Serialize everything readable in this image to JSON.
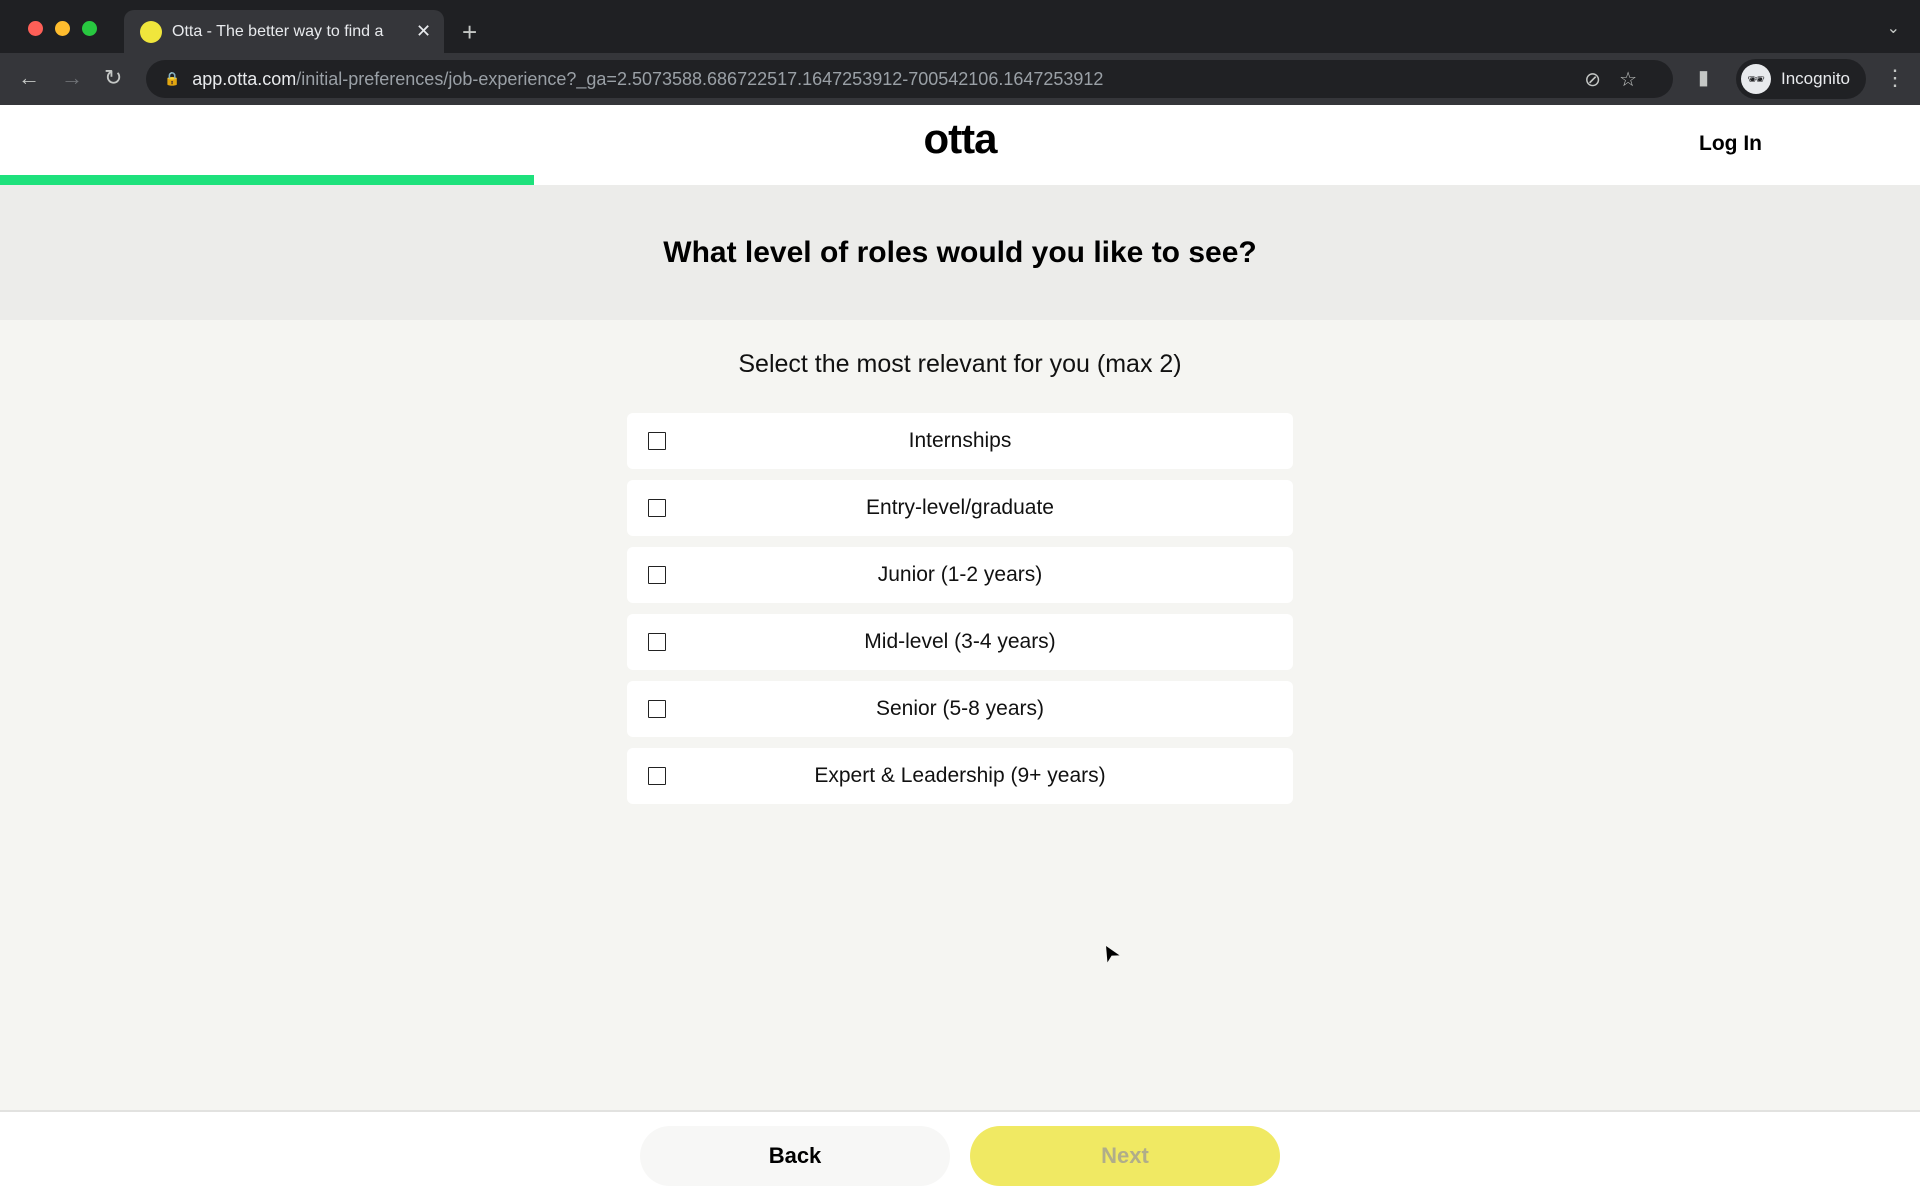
{
  "browser": {
    "tab_title": "Otta - The better way to find a",
    "favicon_text": "otta",
    "url_host": "app.otta.com",
    "url_path": "/initial-preferences/job-experience?_ga=2.5073588.686722517.1647253912-700542106.1647253912",
    "profile_label": "Incognito"
  },
  "header": {
    "logo": "otta",
    "login_label": "Log In",
    "progress_percent": 27.8
  },
  "question": {
    "title": "What level of roles would you like to see?",
    "subtitle": "Select the most relevant for you (max 2)"
  },
  "options": [
    {
      "label": "Internships",
      "checked": false
    },
    {
      "label": "Entry-level/graduate",
      "checked": false
    },
    {
      "label": "Junior (1-2 years)",
      "checked": false
    },
    {
      "label": "Mid-level (3-4 years)",
      "checked": false
    },
    {
      "label": "Senior (5-8 years)",
      "checked": false
    },
    {
      "label": "Expert & Leadership (9+ years)",
      "checked": false
    }
  ],
  "footer": {
    "back_label": "Back",
    "next_label": "Next"
  },
  "colors": {
    "progress": "#1ee17c",
    "next_button": "#f0e963"
  }
}
